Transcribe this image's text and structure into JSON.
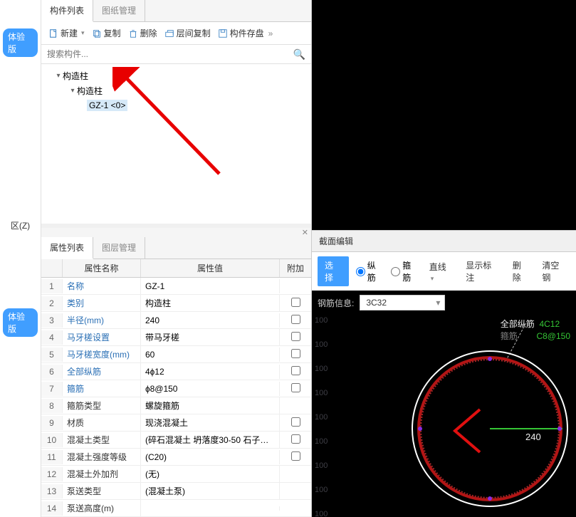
{
  "leftStrip": {
    "badge1": "体验版",
    "zLabel": "区(Z)",
    "badge2": "体验版"
  },
  "componentPanel": {
    "tabs": {
      "list": "构件列表",
      "draw": "图纸管理"
    },
    "toolbar": {
      "new": "新建",
      "copy": "复制",
      "delete": "删除",
      "floorCopy": "层间复制",
      "save": "构件存盘"
    },
    "searchPlaceholder": "搜索构件...",
    "tree": {
      "root": "构造柱",
      "child": "构造柱",
      "leaf": "GZ-1  <0>"
    }
  },
  "propPanel": {
    "tabs": {
      "props": "属性列表",
      "layers": "图层管理"
    },
    "header": {
      "name": "属性名称",
      "value": "属性值",
      "extra": "附加"
    },
    "rows": [
      {
        "n": "1",
        "name": "名称",
        "val": "GZ-1",
        "link": true,
        "chk": null
      },
      {
        "n": "2",
        "name": "类别",
        "val": "构造柱",
        "link": true,
        "chk": false
      },
      {
        "n": "3",
        "name": "半径(mm)",
        "val": "240",
        "link": true,
        "chk": false
      },
      {
        "n": "4",
        "name": "马牙槎设置",
        "val": "带马牙槎",
        "link": true,
        "chk": false
      },
      {
        "n": "5",
        "name": "马牙槎宽度(mm)",
        "val": "60",
        "link": true,
        "chk": false
      },
      {
        "n": "6",
        "name": "全部纵筋",
        "val": "4ɸ12",
        "link": true,
        "chk": false
      },
      {
        "n": "7",
        "name": "箍筋",
        "val": "ɸ8@150",
        "link": true,
        "chk": false
      },
      {
        "n": "8",
        "name": "箍筋类型",
        "val": "螺旋箍筋",
        "link": false,
        "chk": null
      },
      {
        "n": "9",
        "name": "材质",
        "val": "现浇混凝土",
        "link": false,
        "chk": false
      },
      {
        "n": "10",
        "name": "混凝土类型",
        "val": "(碎石混凝土 坍落度30-50 石子…",
        "link": false,
        "chk": false
      },
      {
        "n": "11",
        "name": "混凝土强度等级",
        "val": "(C20)",
        "link": false,
        "chk": false
      },
      {
        "n": "12",
        "name": "混凝土外加剂",
        "val": "(无)",
        "link": false,
        "chk": null
      },
      {
        "n": "13",
        "name": "泵送类型",
        "val": "(混凝土泵)",
        "link": false,
        "chk": null
      },
      {
        "n": "14",
        "name": "泵送高度(m)",
        "val": "",
        "link": false,
        "chk": null
      }
    ]
  },
  "sectionEditor": {
    "title": "截面编辑",
    "select": "选择",
    "longBar": "纵筋",
    "stirrup": "箍筋",
    "line": "直线",
    "showDim": "显示标注",
    "delete": "删除",
    "clear": "清空钢",
    "rebarInfoLabel": "钢筋信息:",
    "rebarInfoValue": "3C32",
    "legend": {
      "allLong": "全部纵筋",
      "allLongVal": "4C12",
      "stirrup": "箍筋",
      "stirrupVal": "C8@150"
    },
    "radius": "240",
    "gridTicks": [
      "100",
      "100",
      "100",
      "100",
      "100",
      "100",
      "100",
      "100",
      "100"
    ]
  }
}
